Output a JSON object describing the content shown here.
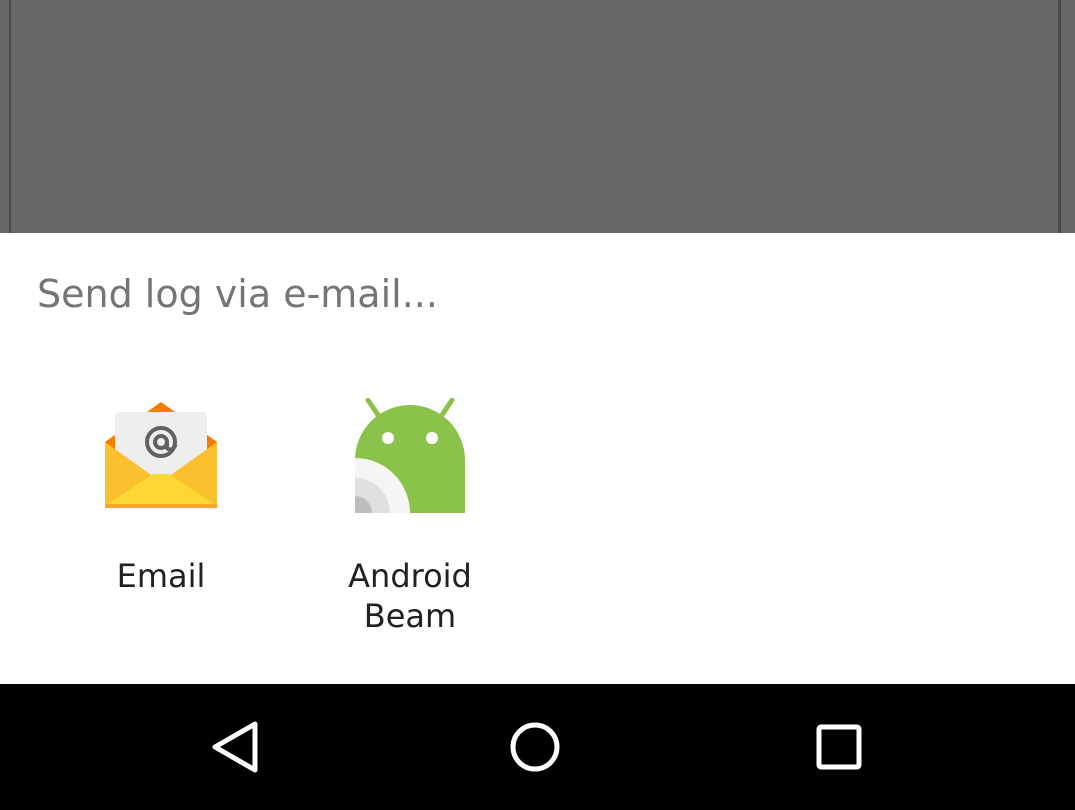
{
  "sheet": {
    "title": "Send log via e-mail..."
  },
  "apps": [
    {
      "label": "Email",
      "icon": "email-app-icon"
    },
    {
      "label": "Android Beam",
      "icon": "android-beam-icon"
    }
  ],
  "navbar": {
    "buttons": [
      "back-icon",
      "home-icon",
      "recents-icon"
    ]
  },
  "colors": {
    "scrim": "#686868",
    "sheet_bg": "#ffffff",
    "title_text": "#757575",
    "label_text": "#212121",
    "android_green": "#8bc34a",
    "envelope_yellow": "#fbc02d",
    "navbar_bg": "#000000"
  }
}
